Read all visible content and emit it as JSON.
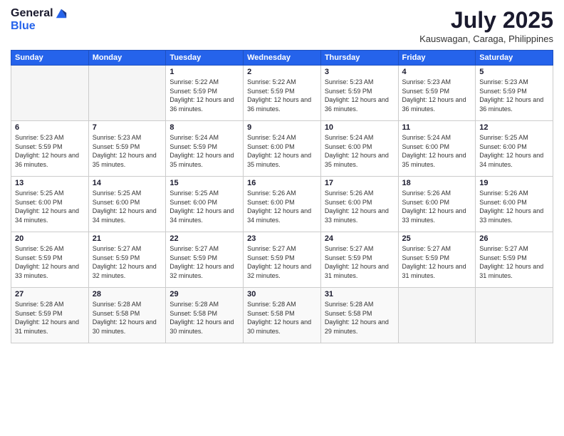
{
  "header": {
    "logo_general": "General",
    "logo_blue": "Blue",
    "title": "July 2025",
    "location": "Kauswagan, Caraga, Philippines"
  },
  "days_of_week": [
    "Sunday",
    "Monday",
    "Tuesday",
    "Wednesday",
    "Thursday",
    "Friday",
    "Saturday"
  ],
  "weeks": [
    [
      {
        "day": "",
        "info": ""
      },
      {
        "day": "",
        "info": ""
      },
      {
        "day": "1",
        "info": "Sunrise: 5:22 AM\nSunset: 5:59 PM\nDaylight: 12 hours and 36 minutes."
      },
      {
        "day": "2",
        "info": "Sunrise: 5:22 AM\nSunset: 5:59 PM\nDaylight: 12 hours and 36 minutes."
      },
      {
        "day": "3",
        "info": "Sunrise: 5:23 AM\nSunset: 5:59 PM\nDaylight: 12 hours and 36 minutes."
      },
      {
        "day": "4",
        "info": "Sunrise: 5:23 AM\nSunset: 5:59 PM\nDaylight: 12 hours and 36 minutes."
      },
      {
        "day": "5",
        "info": "Sunrise: 5:23 AM\nSunset: 5:59 PM\nDaylight: 12 hours and 36 minutes."
      }
    ],
    [
      {
        "day": "6",
        "info": "Sunrise: 5:23 AM\nSunset: 5:59 PM\nDaylight: 12 hours and 36 minutes."
      },
      {
        "day": "7",
        "info": "Sunrise: 5:23 AM\nSunset: 5:59 PM\nDaylight: 12 hours and 35 minutes."
      },
      {
        "day": "8",
        "info": "Sunrise: 5:24 AM\nSunset: 5:59 PM\nDaylight: 12 hours and 35 minutes."
      },
      {
        "day": "9",
        "info": "Sunrise: 5:24 AM\nSunset: 6:00 PM\nDaylight: 12 hours and 35 minutes."
      },
      {
        "day": "10",
        "info": "Sunrise: 5:24 AM\nSunset: 6:00 PM\nDaylight: 12 hours and 35 minutes."
      },
      {
        "day": "11",
        "info": "Sunrise: 5:24 AM\nSunset: 6:00 PM\nDaylight: 12 hours and 35 minutes."
      },
      {
        "day": "12",
        "info": "Sunrise: 5:25 AM\nSunset: 6:00 PM\nDaylight: 12 hours and 34 minutes."
      }
    ],
    [
      {
        "day": "13",
        "info": "Sunrise: 5:25 AM\nSunset: 6:00 PM\nDaylight: 12 hours and 34 minutes."
      },
      {
        "day": "14",
        "info": "Sunrise: 5:25 AM\nSunset: 6:00 PM\nDaylight: 12 hours and 34 minutes."
      },
      {
        "day": "15",
        "info": "Sunrise: 5:25 AM\nSunset: 6:00 PM\nDaylight: 12 hours and 34 minutes."
      },
      {
        "day": "16",
        "info": "Sunrise: 5:26 AM\nSunset: 6:00 PM\nDaylight: 12 hours and 34 minutes."
      },
      {
        "day": "17",
        "info": "Sunrise: 5:26 AM\nSunset: 6:00 PM\nDaylight: 12 hours and 33 minutes."
      },
      {
        "day": "18",
        "info": "Sunrise: 5:26 AM\nSunset: 6:00 PM\nDaylight: 12 hours and 33 minutes."
      },
      {
        "day": "19",
        "info": "Sunrise: 5:26 AM\nSunset: 6:00 PM\nDaylight: 12 hours and 33 minutes."
      }
    ],
    [
      {
        "day": "20",
        "info": "Sunrise: 5:26 AM\nSunset: 5:59 PM\nDaylight: 12 hours and 33 minutes."
      },
      {
        "day": "21",
        "info": "Sunrise: 5:27 AM\nSunset: 5:59 PM\nDaylight: 12 hours and 32 minutes."
      },
      {
        "day": "22",
        "info": "Sunrise: 5:27 AM\nSunset: 5:59 PM\nDaylight: 12 hours and 32 minutes."
      },
      {
        "day": "23",
        "info": "Sunrise: 5:27 AM\nSunset: 5:59 PM\nDaylight: 12 hours and 32 minutes."
      },
      {
        "day": "24",
        "info": "Sunrise: 5:27 AM\nSunset: 5:59 PM\nDaylight: 12 hours and 31 minutes."
      },
      {
        "day": "25",
        "info": "Sunrise: 5:27 AM\nSunset: 5:59 PM\nDaylight: 12 hours and 31 minutes."
      },
      {
        "day": "26",
        "info": "Sunrise: 5:27 AM\nSunset: 5:59 PM\nDaylight: 12 hours and 31 minutes."
      }
    ],
    [
      {
        "day": "27",
        "info": "Sunrise: 5:28 AM\nSunset: 5:59 PM\nDaylight: 12 hours and 31 minutes."
      },
      {
        "day": "28",
        "info": "Sunrise: 5:28 AM\nSunset: 5:58 PM\nDaylight: 12 hours and 30 minutes."
      },
      {
        "day": "29",
        "info": "Sunrise: 5:28 AM\nSunset: 5:58 PM\nDaylight: 12 hours and 30 minutes."
      },
      {
        "day": "30",
        "info": "Sunrise: 5:28 AM\nSunset: 5:58 PM\nDaylight: 12 hours and 30 minutes."
      },
      {
        "day": "31",
        "info": "Sunrise: 5:28 AM\nSunset: 5:58 PM\nDaylight: 12 hours and 29 minutes."
      },
      {
        "day": "",
        "info": ""
      },
      {
        "day": "",
        "info": ""
      }
    ]
  ]
}
